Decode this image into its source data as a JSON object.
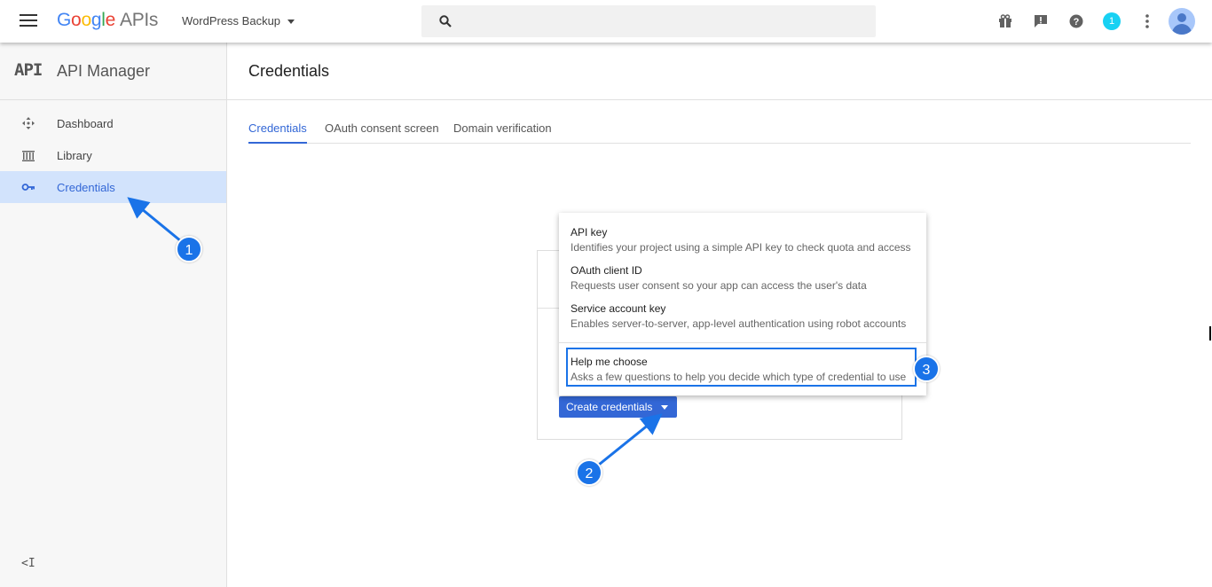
{
  "topbar": {
    "logo": {
      "g": "G",
      "o1": "o",
      "o2": "o",
      "g2": "g",
      "l": "l",
      "e": "e",
      "apis": "APIs"
    },
    "project_name": "WordPress Backup",
    "search_value": "",
    "notification_count": "1",
    "icons": [
      "menu-icon",
      "search-icon",
      "gift-icon",
      "feedback-icon",
      "help-icon",
      "more-vert-icon",
      "avatar-icon"
    ]
  },
  "sidebar": {
    "logo_text": "API",
    "title": "API Manager",
    "items": [
      {
        "label": "Dashboard",
        "icon": "dashboard-icon"
      },
      {
        "label": "Library",
        "icon": "library-icon"
      },
      {
        "label": "Credentials",
        "icon": "key-icon",
        "active": true
      }
    ],
    "collapse_label": "<I"
  },
  "main": {
    "title": "Credentials",
    "tabs": [
      {
        "label": "Credentials",
        "active": true
      },
      {
        "label": "OAuth consent screen"
      },
      {
        "label": "Domain verification"
      }
    ]
  },
  "credentials_menu": {
    "items": [
      {
        "title": "API key",
        "desc": "Identifies your project using a simple API key to check quota and access"
      },
      {
        "title": "OAuth client ID",
        "desc": "Requests user consent so your app can access the user's data"
      },
      {
        "title": "Service account key",
        "desc": "Enables server-to-server, app-level authentication using robot accounts"
      },
      {
        "title": "Help me choose",
        "desc": "Asks a few questions to help you decide which type of credential to use"
      }
    ]
  },
  "create_button": {
    "label": "Create credentials"
  },
  "callouts": [
    "1",
    "2",
    "3"
  ],
  "colors": {
    "accent": "#3367d6",
    "callout": "#1a73e8",
    "active_bg": "#d2e3fc"
  }
}
